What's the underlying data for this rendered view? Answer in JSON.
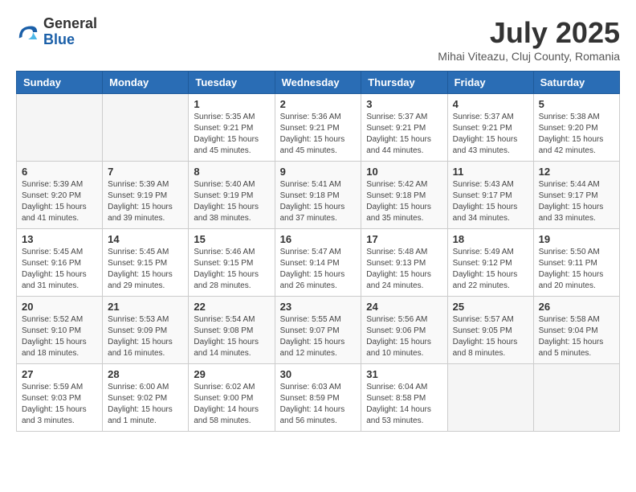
{
  "logo": {
    "general": "General",
    "blue": "Blue"
  },
  "title": "July 2025",
  "location": "Mihai Viteazu, Cluj County, Romania",
  "weekdays": [
    "Sunday",
    "Monday",
    "Tuesday",
    "Wednesday",
    "Thursday",
    "Friday",
    "Saturday"
  ],
  "weeks": [
    [
      {
        "day": "",
        "info": ""
      },
      {
        "day": "",
        "info": ""
      },
      {
        "day": "1",
        "info": "Sunrise: 5:35 AM\nSunset: 9:21 PM\nDaylight: 15 hours and 45 minutes."
      },
      {
        "day": "2",
        "info": "Sunrise: 5:36 AM\nSunset: 9:21 PM\nDaylight: 15 hours and 45 minutes."
      },
      {
        "day": "3",
        "info": "Sunrise: 5:37 AM\nSunset: 9:21 PM\nDaylight: 15 hours and 44 minutes."
      },
      {
        "day": "4",
        "info": "Sunrise: 5:37 AM\nSunset: 9:21 PM\nDaylight: 15 hours and 43 minutes."
      },
      {
        "day": "5",
        "info": "Sunrise: 5:38 AM\nSunset: 9:20 PM\nDaylight: 15 hours and 42 minutes."
      }
    ],
    [
      {
        "day": "6",
        "info": "Sunrise: 5:39 AM\nSunset: 9:20 PM\nDaylight: 15 hours and 41 minutes."
      },
      {
        "day": "7",
        "info": "Sunrise: 5:39 AM\nSunset: 9:19 PM\nDaylight: 15 hours and 39 minutes."
      },
      {
        "day": "8",
        "info": "Sunrise: 5:40 AM\nSunset: 9:19 PM\nDaylight: 15 hours and 38 minutes."
      },
      {
        "day": "9",
        "info": "Sunrise: 5:41 AM\nSunset: 9:18 PM\nDaylight: 15 hours and 37 minutes."
      },
      {
        "day": "10",
        "info": "Sunrise: 5:42 AM\nSunset: 9:18 PM\nDaylight: 15 hours and 35 minutes."
      },
      {
        "day": "11",
        "info": "Sunrise: 5:43 AM\nSunset: 9:17 PM\nDaylight: 15 hours and 34 minutes."
      },
      {
        "day": "12",
        "info": "Sunrise: 5:44 AM\nSunset: 9:17 PM\nDaylight: 15 hours and 33 minutes."
      }
    ],
    [
      {
        "day": "13",
        "info": "Sunrise: 5:45 AM\nSunset: 9:16 PM\nDaylight: 15 hours and 31 minutes."
      },
      {
        "day": "14",
        "info": "Sunrise: 5:45 AM\nSunset: 9:15 PM\nDaylight: 15 hours and 29 minutes."
      },
      {
        "day": "15",
        "info": "Sunrise: 5:46 AM\nSunset: 9:15 PM\nDaylight: 15 hours and 28 minutes."
      },
      {
        "day": "16",
        "info": "Sunrise: 5:47 AM\nSunset: 9:14 PM\nDaylight: 15 hours and 26 minutes."
      },
      {
        "day": "17",
        "info": "Sunrise: 5:48 AM\nSunset: 9:13 PM\nDaylight: 15 hours and 24 minutes."
      },
      {
        "day": "18",
        "info": "Sunrise: 5:49 AM\nSunset: 9:12 PM\nDaylight: 15 hours and 22 minutes."
      },
      {
        "day": "19",
        "info": "Sunrise: 5:50 AM\nSunset: 9:11 PM\nDaylight: 15 hours and 20 minutes."
      }
    ],
    [
      {
        "day": "20",
        "info": "Sunrise: 5:52 AM\nSunset: 9:10 PM\nDaylight: 15 hours and 18 minutes."
      },
      {
        "day": "21",
        "info": "Sunrise: 5:53 AM\nSunset: 9:09 PM\nDaylight: 15 hours and 16 minutes."
      },
      {
        "day": "22",
        "info": "Sunrise: 5:54 AM\nSunset: 9:08 PM\nDaylight: 15 hours and 14 minutes."
      },
      {
        "day": "23",
        "info": "Sunrise: 5:55 AM\nSunset: 9:07 PM\nDaylight: 15 hours and 12 minutes."
      },
      {
        "day": "24",
        "info": "Sunrise: 5:56 AM\nSunset: 9:06 PM\nDaylight: 15 hours and 10 minutes."
      },
      {
        "day": "25",
        "info": "Sunrise: 5:57 AM\nSunset: 9:05 PM\nDaylight: 15 hours and 8 minutes."
      },
      {
        "day": "26",
        "info": "Sunrise: 5:58 AM\nSunset: 9:04 PM\nDaylight: 15 hours and 5 minutes."
      }
    ],
    [
      {
        "day": "27",
        "info": "Sunrise: 5:59 AM\nSunset: 9:03 PM\nDaylight: 15 hours and 3 minutes."
      },
      {
        "day": "28",
        "info": "Sunrise: 6:00 AM\nSunset: 9:02 PM\nDaylight: 15 hours and 1 minute."
      },
      {
        "day": "29",
        "info": "Sunrise: 6:02 AM\nSunset: 9:00 PM\nDaylight: 14 hours and 58 minutes."
      },
      {
        "day": "30",
        "info": "Sunrise: 6:03 AM\nSunset: 8:59 PM\nDaylight: 14 hours and 56 minutes."
      },
      {
        "day": "31",
        "info": "Sunrise: 6:04 AM\nSunset: 8:58 PM\nDaylight: 14 hours and 53 minutes."
      },
      {
        "day": "",
        "info": ""
      },
      {
        "day": "",
        "info": ""
      }
    ]
  ]
}
